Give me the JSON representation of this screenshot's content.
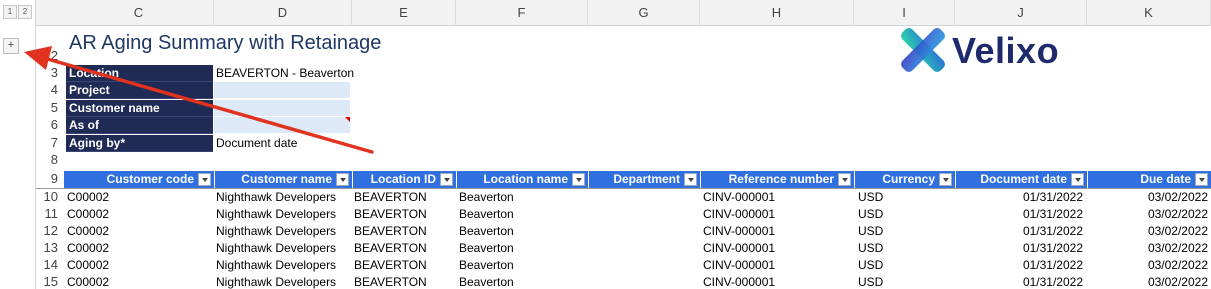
{
  "outline": {
    "level_buttons": [
      "1",
      "2"
    ],
    "expand_button": "+"
  },
  "columns": [
    "C",
    "D",
    "E",
    "F",
    "G",
    "H",
    "I",
    "J",
    "K"
  ],
  "rows": [
    "2",
    "3",
    "4",
    "5",
    "6",
    "7",
    "8",
    "9",
    "10",
    "11",
    "12",
    "13",
    "14",
    "15"
  ],
  "report": {
    "title": "AR Aging Summary with Retainage",
    "logo_text": "Velixo",
    "params": [
      {
        "label": "Location",
        "value": "BEAVERTON - Beaverton"
      },
      {
        "label": "Project",
        "value": ""
      },
      {
        "label": "Customer name",
        "value": ""
      },
      {
        "label": "As of",
        "value": ""
      },
      {
        "label": "Aging by*",
        "value": "Document date"
      }
    ]
  },
  "table": {
    "headers": [
      "Customer code",
      "Customer name",
      "Location ID",
      "Location name",
      "Department",
      "Reference number",
      "Currency",
      "Document date",
      "Due date"
    ],
    "rows": [
      [
        "C00002",
        "Nighthawk Developers",
        "BEAVERTON",
        "Beaverton",
        "",
        "CINV-000001",
        "USD",
        "01/31/2022",
        "03/02/2022"
      ],
      [
        "C00002",
        "Nighthawk Developers",
        "BEAVERTON",
        "Beaverton",
        "",
        "CINV-000001",
        "USD",
        "01/31/2022",
        "03/02/2022"
      ],
      [
        "C00002",
        "Nighthawk Developers",
        "BEAVERTON",
        "Beaverton",
        "",
        "CINV-000001",
        "USD",
        "01/31/2022",
        "03/02/2022"
      ],
      [
        "C00002",
        "Nighthawk Developers",
        "BEAVERTON",
        "Beaverton",
        "",
        "CINV-000001",
        "USD",
        "01/31/2022",
        "03/02/2022"
      ],
      [
        "C00002",
        "Nighthawk Developers",
        "BEAVERTON",
        "Beaverton",
        "",
        "CINV-000001",
        "USD",
        "01/31/2022",
        "03/02/2022"
      ],
      [
        "C00002",
        "Nighthawk Developers",
        "BEAVERTON",
        "Beaverton",
        "",
        "CINV-000001",
        "USD",
        "01/31/2022",
        "03/02/2022"
      ]
    ]
  },
  "colors": {
    "param_label_bg": "#1f2a55",
    "param_value_bg": "#dde9f7",
    "table_header_bg": "#2f6fe0",
    "title_color": "#1f3864",
    "annotation_arrow": "#e0321e",
    "logo_text": "#1e2a6b"
  }
}
